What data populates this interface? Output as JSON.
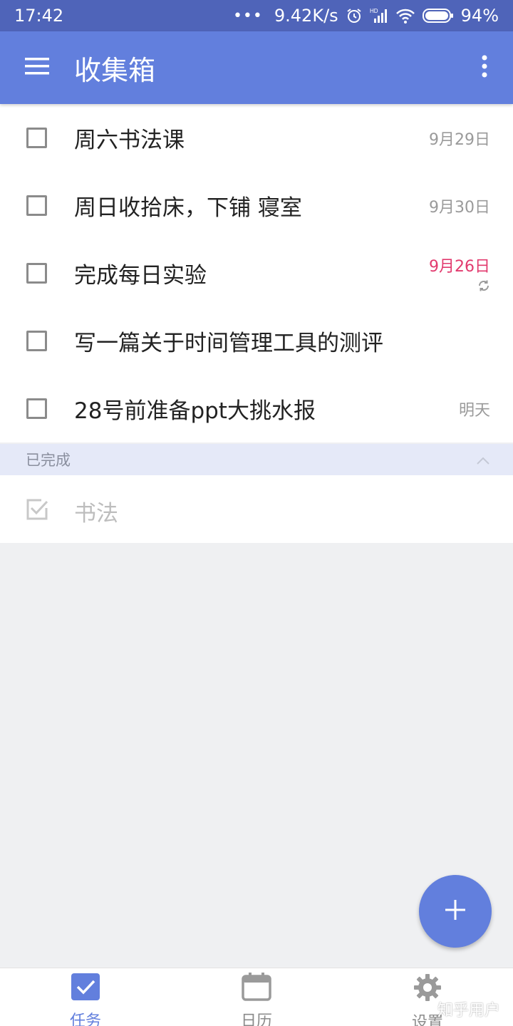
{
  "status_bar": {
    "time": "17:42",
    "dots": "•••",
    "network_speed": "9.42K/s",
    "battery": "94%",
    "icons": [
      "alarm-icon",
      "signal-hd-icon",
      "wifi-icon",
      "battery-icon"
    ]
  },
  "app_bar": {
    "title": "收集箱",
    "menu_icon": "hamburger-menu-icon",
    "more_icon": "more-vert-icon"
  },
  "tasks": [
    {
      "title": "周六书法课",
      "date": "9月29日",
      "overdue": false,
      "repeat": false
    },
    {
      "title": "周日收拾床，下铺 寝室",
      "date": "9月30日",
      "overdue": false,
      "repeat": false
    },
    {
      "title": "完成每日实验",
      "date": "9月26日",
      "overdue": true,
      "repeat": true
    },
    {
      "title": "写一篇关于时间管理工具的测评",
      "date": "",
      "overdue": false,
      "repeat": false
    },
    {
      "title": "28号前准备ppt大挑水报",
      "date": "明天",
      "overdue": false,
      "repeat": false
    }
  ],
  "completed_section": {
    "label": "已完成",
    "items": [
      {
        "title": "书法"
      }
    ]
  },
  "fab": {
    "icon": "plus-icon"
  },
  "bottom_nav": {
    "items": [
      {
        "label": "任务",
        "icon": "task-check-icon",
        "active": true
      },
      {
        "label": "日历",
        "icon": "calendar-icon",
        "active": false
      },
      {
        "label": "设置",
        "icon": "gear-icon",
        "active": false
      }
    ]
  },
  "watermark": "知乎用户",
  "colors": {
    "primary": "#627fdd",
    "status_bar": "#4f64b9",
    "overdue": "#e23a6e",
    "section_bg": "#e5e9f8",
    "background": "#eff0f2"
  }
}
